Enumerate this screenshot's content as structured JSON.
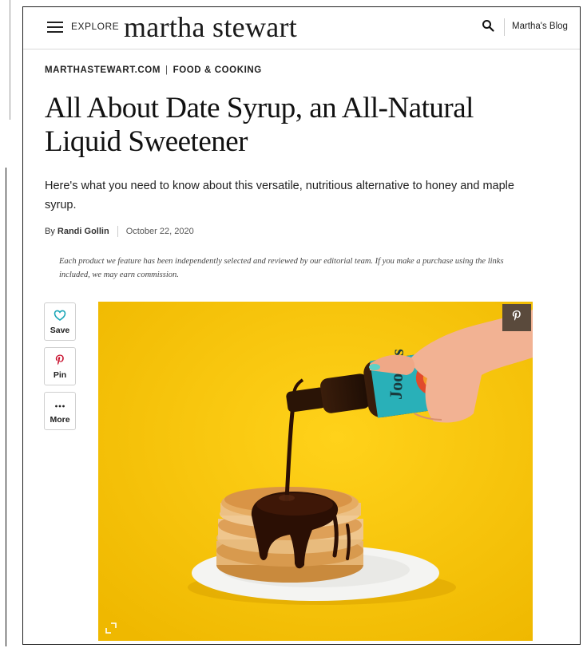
{
  "header": {
    "explore_label": "EXPLORE",
    "logo_text": "martha stewart",
    "blog_link": "Martha's Blog"
  },
  "breadcrumb": {
    "site": "MARTHASTEWART.COM",
    "separator": "|",
    "section": "FOOD & COOKING"
  },
  "article": {
    "title": "All About Date Syrup, an All-Natural Liquid Sweetener",
    "dek": "Here's what you need to know about this versatile, nutritious alternative to honey and maple syrup.",
    "byline_prefix": "By",
    "author": "Randi Gollin",
    "date": "October 22, 2020",
    "disclaimer": "Each product we feature has been independently selected and reviewed by our editorial team. If you make a purchase using the links included, we may earn commission."
  },
  "share": {
    "save_label": "Save",
    "pin_label": "Pin",
    "more_label": "More"
  },
  "hero": {
    "bottle_label": "Joolies",
    "icons": [
      "pinterest-icon",
      "expand-icon"
    ]
  },
  "colors": {
    "accent_teal": "#1aa6b7",
    "pinterest_red": "#c8102e",
    "hero_yellow": "#f5c400"
  }
}
